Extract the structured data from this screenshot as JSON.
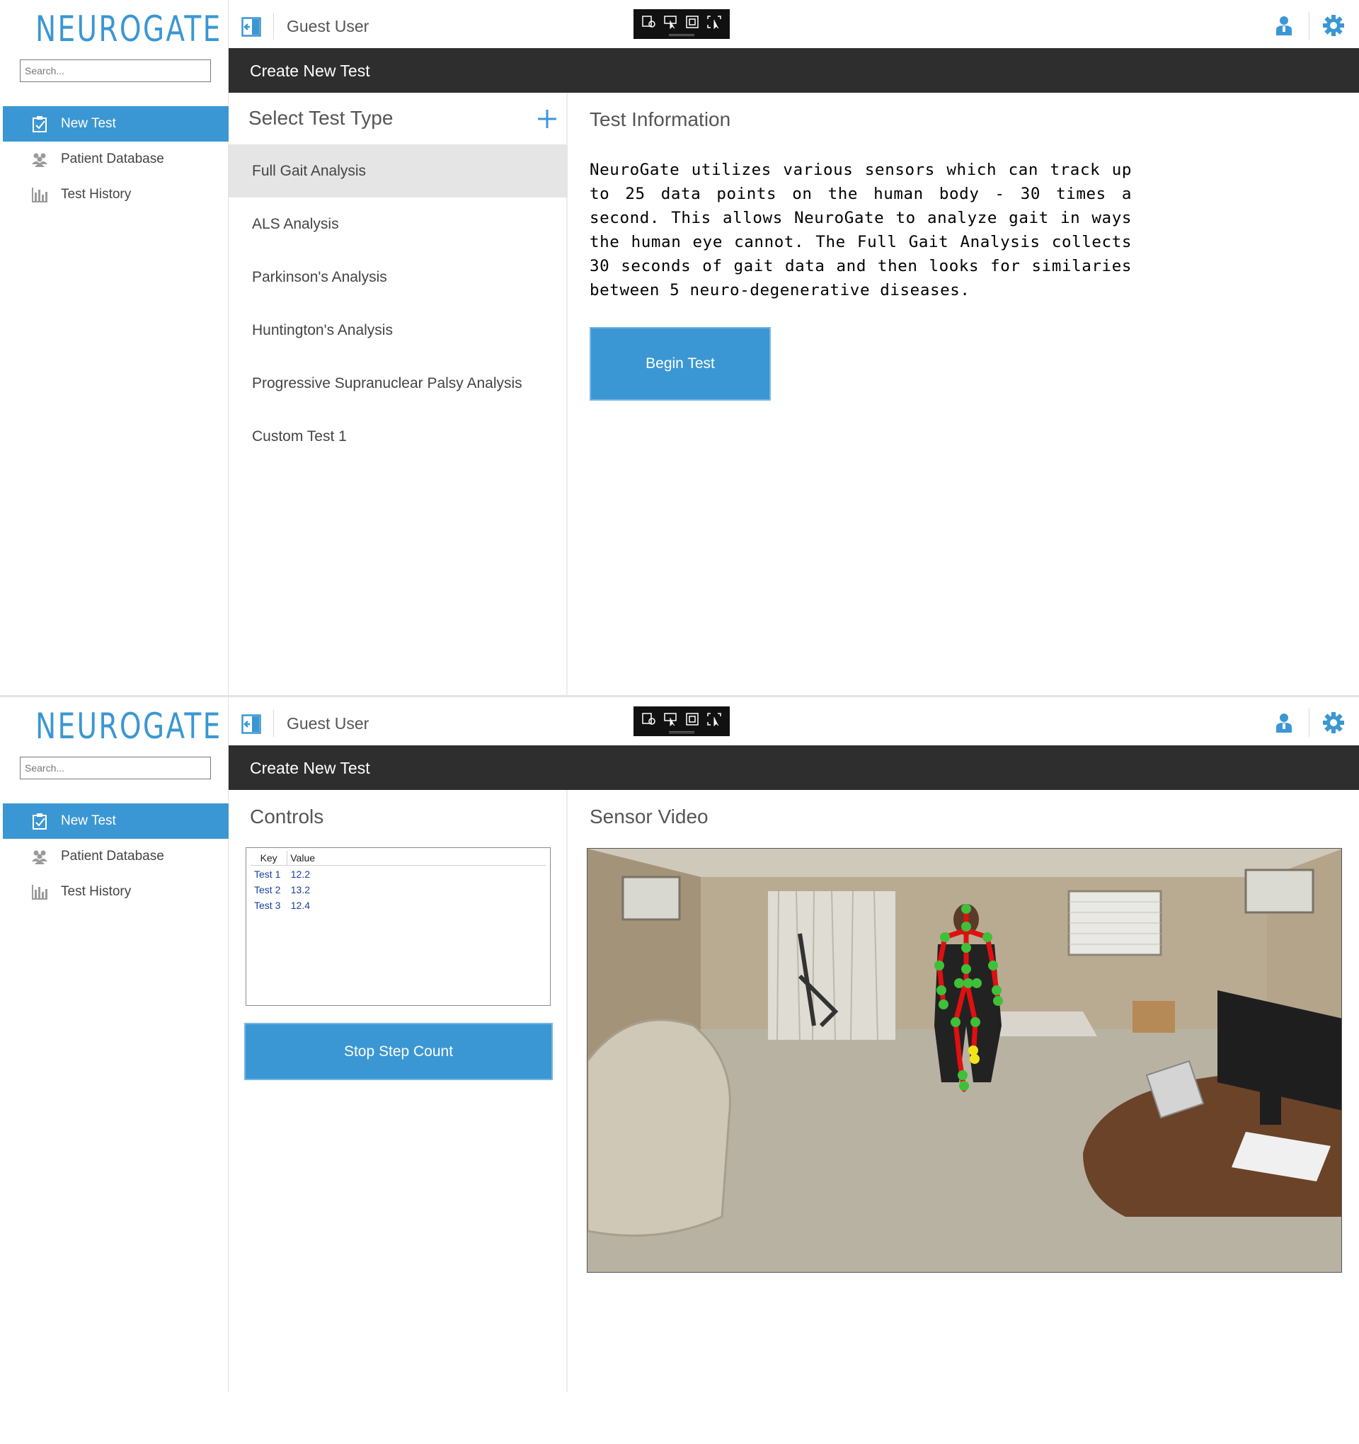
{
  "app": {
    "logo_text": "NEUROGATE",
    "search_placeholder": "Search...",
    "username": "Guest User",
    "title": "Create New Test",
    "brand_color": "#3b97d3",
    "titlebar_color": "#2e2e2e"
  },
  "sidebar": {
    "items": [
      {
        "label": "New Test",
        "icon": "clipboard-icon",
        "active": true
      },
      {
        "label": "Patient Database",
        "icon": "people-icon",
        "active": false
      },
      {
        "label": "Test History",
        "icon": "bar-chart-icon",
        "active": false
      }
    ]
  },
  "capture_toolbar": {
    "icons": [
      "snip-settings-icon",
      "pointer-capture-icon",
      "window-capture-icon",
      "fullscreen-capture-icon"
    ]
  },
  "screen1": {
    "list_heading": "Select Test Type",
    "test_types": [
      "Full Gait Analysis",
      "ALS Analysis",
      "Parkinson's Analysis",
      "Huntington's Analysis",
      "Progressive Supranuclear Palsy Analysis",
      "Custom Test 1"
    ],
    "selected_test": "Full Gait Analysis",
    "info_heading": "Test Information",
    "info_text": "NeuroGate utilizes various sensors which can track up to 25 data points on the human body - 30 times a second. This allows NeuroGate to analyze gait in ways the human eye cannot. The Full Gait Analysis collects 30 seconds of gait data and then looks for similaries between 5 neuro-degenerative diseases.",
    "begin_button": "Begin Test"
  },
  "screen2": {
    "controls_heading": "Controls",
    "table": {
      "headers": [
        "Key",
        "Value"
      ],
      "rows": [
        {
          "key": "Test 1",
          "value": "12.2"
        },
        {
          "key": "Test 2",
          "value": "13.2"
        },
        {
          "key": "Test 3",
          "value": "12.4"
        }
      ]
    },
    "stop_button": "Stop Step Count",
    "video_heading": "Sensor Video"
  }
}
